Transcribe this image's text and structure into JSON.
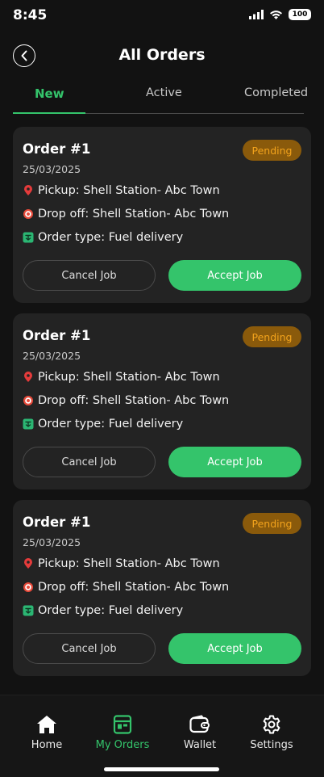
{
  "status_bar": {
    "time": "8:45",
    "battery": "100"
  },
  "header": {
    "title": "All Orders"
  },
  "tabs": [
    {
      "label": "New",
      "selected": true
    },
    {
      "label": "Active",
      "selected": false
    },
    {
      "label": "Completed",
      "selected": false
    }
  ],
  "orders": [
    {
      "title": "Order #1",
      "date": "25/03/2025",
      "status": "Pending",
      "pickup": "Pickup: Shell Station- Abc Town",
      "dropoff": "Drop off: Shell Station- Abc Town",
      "type": "Order type: Fuel delivery",
      "cancel_label": "Cancel Job",
      "accept_label": "Accept Job"
    },
    {
      "title": "Order #1",
      "date": "25/03/2025",
      "status": "Pending",
      "pickup": "Pickup: Shell Station- Abc Town",
      "dropoff": "Drop off: Shell Station- Abc Town",
      "type": "Order type: Fuel delivery",
      "cancel_label": "Cancel Job",
      "accept_label": "Accept Job"
    },
    {
      "title": "Order #1",
      "date": "25/03/2025",
      "status": "Pending",
      "pickup": "Pickup: Shell Station- Abc Town",
      "dropoff": "Drop off: Shell Station- Abc Town",
      "type": "Order type: Fuel delivery",
      "cancel_label": "Cancel Job",
      "accept_label": "Accept Job"
    }
  ],
  "bottom_nav": [
    {
      "label": "Home",
      "icon": "home-icon",
      "active": false
    },
    {
      "label": "My Orders",
      "icon": "orders-icon",
      "active": true
    },
    {
      "label": "Wallet",
      "icon": "wallet-icon",
      "active": false
    },
    {
      "label": "Settings",
      "icon": "gear-icon",
      "active": false
    }
  ],
  "colors": {
    "accent": "#34c46b",
    "background": "#121212",
    "card": "#232323",
    "pending_bg": "#8a5a0b",
    "pending_text": "#f3a31c"
  }
}
